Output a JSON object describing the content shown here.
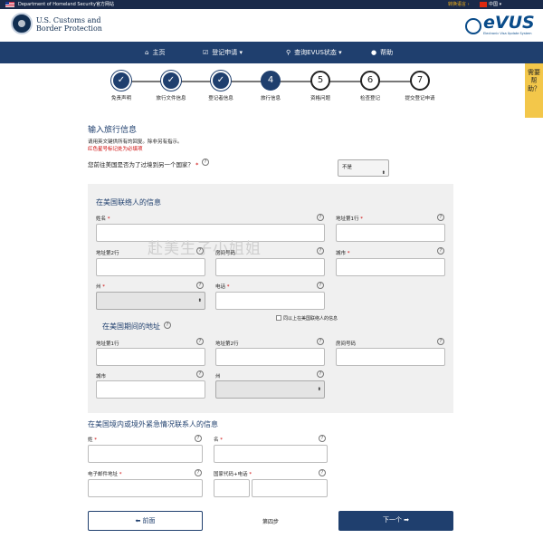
{
  "topbar": {
    "dhs": "Department of Homeland Security官方网站",
    "change_lang": "转换语言 ›",
    "lang": "中国 ▾"
  },
  "header": {
    "agency_line1": "U.S. Customs and",
    "agency_line2": "Border Protection",
    "evus": "eVUS",
    "evus_sub": "Electronic Visa Update System"
  },
  "nav": {
    "home": "主页",
    "register": "登记申请 ▾",
    "check": "查询EVUS状态 ▾",
    "help": "帮助"
  },
  "steps": [
    {
      "mark": "✓",
      "label": "免责声明"
    },
    {
      "mark": "✓",
      "label": "旅行文件信息"
    },
    {
      "mark": "✓",
      "label": "登记者信息"
    },
    {
      "mark": "4",
      "label": "旅行信息"
    },
    {
      "mark": "5",
      "label": "资格问题"
    },
    {
      "mark": "6",
      "label": "检查登记"
    },
    {
      "mark": "7",
      "label": "提交登记申请"
    }
  ],
  "help_tab": "需要帮助？",
  "page": {
    "title": "输入旅行信息",
    "note1": "请用英文键供所有的回复。除非另有指示。",
    "note2": "红色星号标记处为必填项",
    "question": "您前往美国是否为了过境到另一个国家？",
    "question_req": "*",
    "transit_value": "不是"
  },
  "contact": {
    "title": "在美国联络人的信息",
    "name": "姓名",
    "addr1": "地址第1行",
    "addr2": "地址第2行",
    "room": "房间号码",
    "city": "城市",
    "state": "州",
    "phone": "电话",
    "same_as": "同以上在美国联络人的信息"
  },
  "stay": {
    "title": "在美国期间的地址",
    "addr1": "地址第1行",
    "addr2": "地址第2行",
    "room": "房间号码",
    "city": "城市",
    "state": "州"
  },
  "emergency": {
    "title": "在美国境内或境外紧急情况联系人的信息",
    "surname": "姓",
    "given": "名",
    "email": "电子邮件地址",
    "country_phone": "国家代码+电话"
  },
  "watermark": "赴美生子小姐姐",
  "footer": {
    "prev": "⬅ 前面",
    "step": "第四步",
    "next": "下一个 ➡"
  }
}
